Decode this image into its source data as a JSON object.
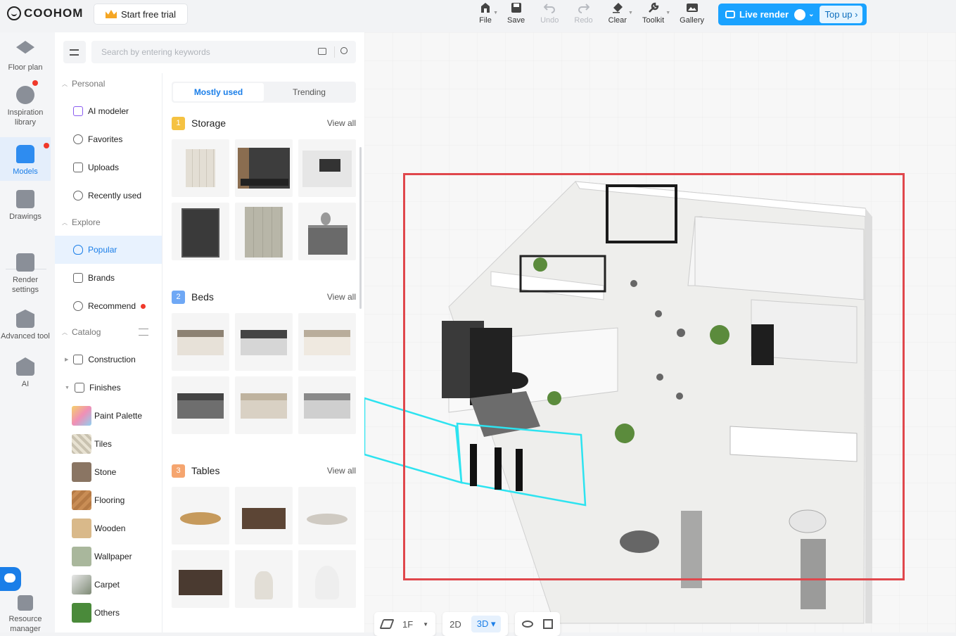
{
  "brand": {
    "name": "COOHOM"
  },
  "header": {
    "trial_label": "Start free trial"
  },
  "toolbar": {
    "file": "File",
    "save": "Save",
    "undo": "Undo",
    "redo": "Redo",
    "clear": "Clear",
    "toolkit": "Toolkit",
    "gallery": "Gallery"
  },
  "live_render": {
    "label": "Live render",
    "topup": "Top up"
  },
  "rail": {
    "floor_plan": "Floor plan",
    "inspiration": "Inspiration library",
    "models": "Models",
    "drawings": "Drawings",
    "render_settings": "Render settings",
    "advanced_tool": "Advanced tool",
    "ai": "AI",
    "resource_manager": "Resource manager"
  },
  "search": {
    "placeholder": "Search by entering keywords"
  },
  "categories": {
    "personal_title": "Personal",
    "ai_modeler": "AI modeler",
    "favorites": "Favorites",
    "uploads": "Uploads",
    "recently_used": "Recently used",
    "explore_title": "Explore",
    "popular": "Popular",
    "brands": "Brands",
    "recommend": "Recommend",
    "catalog_title": "Catalog",
    "construction": "Construction",
    "finishes": "Finishes",
    "materials": [
      {
        "label": "Paint Palette",
        "color": "#e8b36c"
      },
      {
        "label": "Tiles",
        "color": "#c9c2b0"
      },
      {
        "label": "Stone",
        "color": "#8a7563"
      },
      {
        "label": "Flooring",
        "color": "#b57a45"
      },
      {
        "label": "Wooden",
        "color": "#d9b98a"
      },
      {
        "label": "Wallpaper",
        "color": "#a9b79c"
      },
      {
        "label": "Carpet",
        "color": "#7e8a76"
      },
      {
        "label": "Others",
        "color": "#4a8a3a"
      }
    ]
  },
  "tabs": {
    "mostly_used": "Mostly used",
    "trending": "Trending"
  },
  "groups": [
    {
      "num": "1",
      "title": "Storage",
      "view_all": "View all",
      "badge_color": "#f5c242"
    },
    {
      "num": "2",
      "title": "Beds",
      "view_all": "View all",
      "badge_color": "#6fa8f5"
    },
    {
      "num": "3",
      "title": "Tables",
      "view_all": "View all",
      "badge_color": "#f5a56f"
    }
  ],
  "bottom": {
    "floor": "1F",
    "mode_2d": "2D",
    "mode_3d": "3D"
  },
  "colors": {
    "accent": "#1a7ee8",
    "live_render": "#1aa2ff",
    "selection": "#e0474c"
  }
}
